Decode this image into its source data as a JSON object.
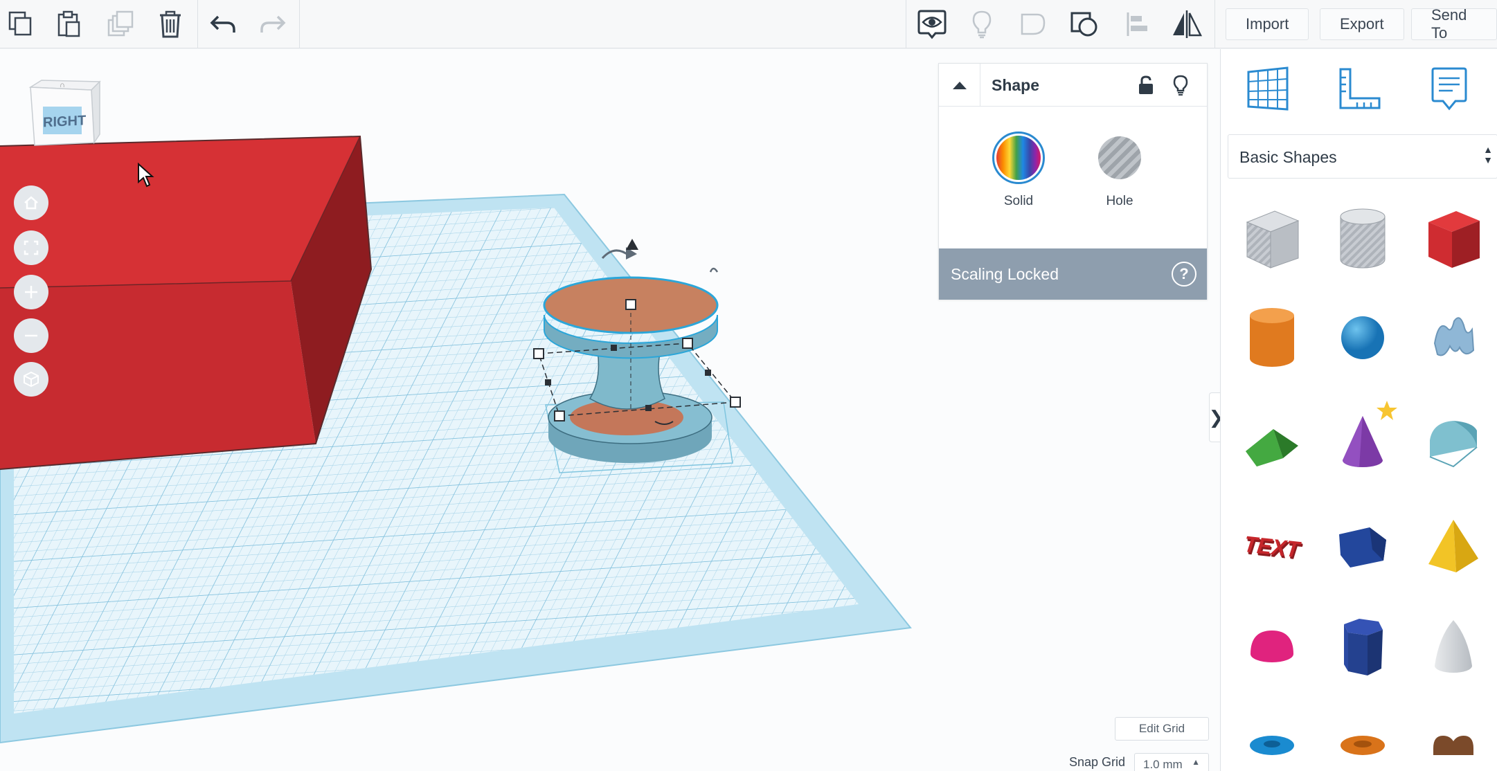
{
  "toolbar": {
    "import_label": "Import",
    "export_label": "Export",
    "send_to_label": "Send To"
  },
  "viewcube": {
    "label": "RIGHT"
  },
  "inspector": {
    "title": "Shape",
    "solid_label": "Solid",
    "hole_label": "Hole",
    "scaling_text": "Scaling Locked",
    "help_glyph": "?"
  },
  "grid": {
    "edit_label": "Edit Grid",
    "snap_label": "Snap Grid",
    "snap_value": "1.0 mm"
  },
  "right_panel": {
    "category": "Basic Shapes",
    "text_shape_label": "TEXT"
  },
  "colors": {
    "box_red": "#d63135",
    "workplane_blue": "#a9d8ec",
    "selected_shape": "#7fb9cb",
    "copper": "#c78160",
    "scaling_bar": "#8e9eae",
    "accent_blue": "#2a8ad0"
  }
}
